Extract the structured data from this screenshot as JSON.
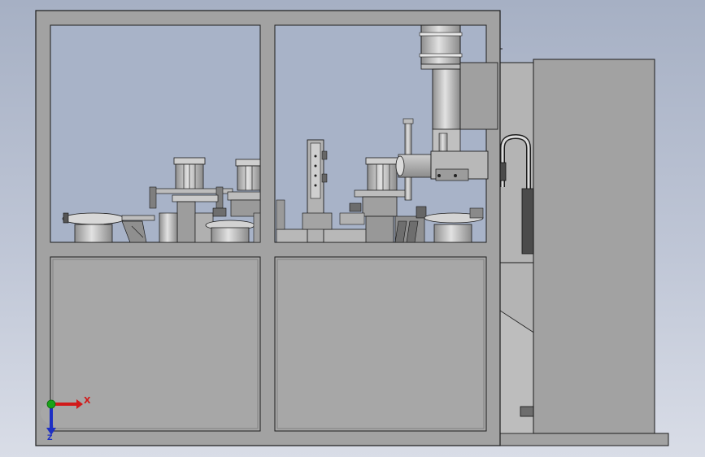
{
  "view": {
    "background_top": "#a6b0c4",
    "background_bottom": "#d9dde7",
    "frame_color": "#a2a2a2",
    "panel_color": "#a7a7a7",
    "edge_color": "#1c1c1c",
    "metal_color": "#c9c9c9"
  },
  "triad": {
    "x_label": "X",
    "z_label": "Z",
    "x_color": "#d11a1a",
    "y_color": "#19a319",
    "z_color": "#1d2fc4"
  }
}
